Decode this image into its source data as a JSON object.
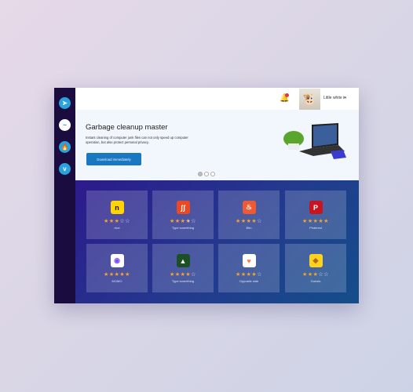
{
  "sidebar": {
    "icons": [
      {
        "name": "telegram-icon",
        "color": "#2aa3dc",
        "glyph": "➤"
      },
      {
        "name": "messenger-icon",
        "color": "#0a84ff",
        "glyph": "~"
      },
      {
        "name": "tinder-icon",
        "color": "#2aa3dc",
        "glyph": "🔥"
      },
      {
        "name": "vimeo-icon",
        "color": "#2aa3dc",
        "glyph": "v"
      }
    ]
  },
  "header": {
    "notification_count": "1",
    "user_name": "Little white in"
  },
  "banner": {
    "title": "Garbage cleanup master",
    "description": "Instant cleaning of computer junk files can not only speed up computer operation, but also protect personal privacy.",
    "button": "Download immediately",
    "slides": 3,
    "active_slide": 1
  },
  "apps": [
    {
      "label": "nice",
      "rating": 3,
      "icon": "n",
      "bg": "#ffd400",
      "fg": "#111"
    },
    {
      "label": "Type something",
      "rating": 3.5,
      "icon": "ʃʃ",
      "bg": "#eb4924",
      "fg": "#fff"
    },
    {
      "label": "Btin",
      "rating": 4,
      "icon": "♨",
      "bg": "#ef5a33",
      "fg": "#fff"
    },
    {
      "label": "Pinterest",
      "rating": 5,
      "icon": "P",
      "bg": "#c8141e",
      "fg": "#fff"
    },
    {
      "label": "MOMO",
      "rating": 5,
      "icon": "◉",
      "bg": "#ffffff",
      "fg": "#7a4bff"
    },
    {
      "label": "Type something",
      "rating": 4,
      "icon": "▲",
      "bg": "#1d4f24",
      "fg": "#fff"
    },
    {
      "label": "Opposite side",
      "rating": 4,
      "icon": "♥",
      "bg": "#ffffff",
      "fg": "#ff7a45"
    },
    {
      "label": "Guests",
      "rating": 3,
      "icon": "◆",
      "bg": "#ffd21e",
      "fg": "#b06a1a"
    }
  ]
}
